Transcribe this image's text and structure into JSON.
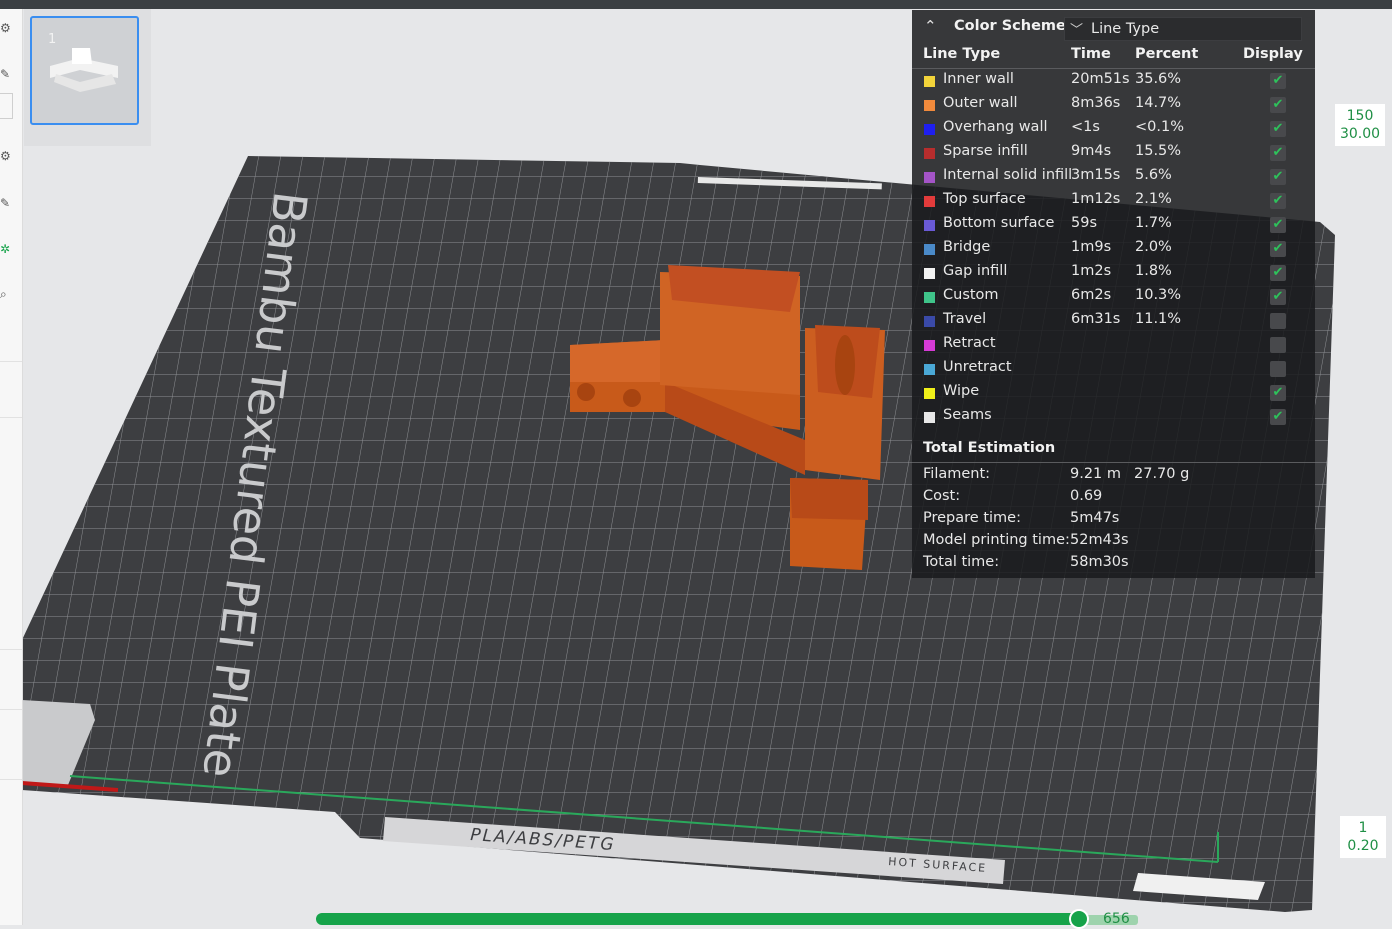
{
  "plate": {
    "name": "Bambu Textured PEI Plate",
    "filament_label": "PLA/ABS/PETG",
    "hot_surface_label": "HOT SURFACE",
    "thumbnail_number": "1"
  },
  "color_scheme": {
    "title": "Color Scheme",
    "selected": "Line Type",
    "columns": {
      "line_type": "Line Type",
      "time": "Time",
      "percent": "Percent",
      "display": "Display"
    },
    "rows": [
      {
        "name": "Inner wall",
        "time": "20m51s",
        "percent": "35.6%",
        "color": "#f3d43a",
        "display": true
      },
      {
        "name": "Outer wall",
        "time": "8m36s",
        "percent": "14.7%",
        "color": "#f18a3c",
        "display": true
      },
      {
        "name": "Overhang wall",
        "time": "<1s",
        "percent": "<0.1%",
        "color": "#1f1ff0",
        "display": true
      },
      {
        "name": "Sparse infill",
        "time": "9m4s",
        "percent": "15.5%",
        "color": "#b72d2d",
        "display": true
      },
      {
        "name": "Internal solid infill",
        "time": "3m15s",
        "percent": "5.6%",
        "color": "#a454c7",
        "display": true
      },
      {
        "name": "Top surface",
        "time": "1m12s",
        "percent": "2.1%",
        "color": "#e33b3b",
        "display": true
      },
      {
        "name": "Bottom surface",
        "time": "59s",
        "percent": "1.7%",
        "color": "#6a5ad6",
        "display": true
      },
      {
        "name": "Bridge",
        "time": "1m9s",
        "percent": "2.0%",
        "color": "#4a8ac9",
        "display": true
      },
      {
        "name": "Gap infill",
        "time": "1m2s",
        "percent": "1.8%",
        "color": "#f2f2f2",
        "display": true
      },
      {
        "name": "Custom",
        "time": "6m2s",
        "percent": "10.3%",
        "color": "#3fc48a",
        "display": true
      },
      {
        "name": "Travel",
        "time": "6m31s",
        "percent": "11.1%",
        "color": "#3a4aa8",
        "display": false
      },
      {
        "name": "Retract",
        "time": "",
        "percent": "",
        "color": "#d63bd6",
        "display": false
      },
      {
        "name": "Unretract",
        "time": "",
        "percent": "",
        "color": "#4aa8d6",
        "display": false
      },
      {
        "name": "Wipe",
        "time": "",
        "percent": "",
        "color": "#f0f01a",
        "display": true
      },
      {
        "name": "Seams",
        "time": "",
        "percent": "",
        "color": "#e8e8e8",
        "display": true
      }
    ]
  },
  "total_estimation": {
    "title": "Total Estimation",
    "filament_label": "Filament:",
    "filament_length": "9.21 m",
    "filament_weight": "27.70 g",
    "cost_label": "Cost:",
    "cost": "0.69",
    "prepare_label": "Prepare time:",
    "prepare": "5m47s",
    "model_label": "Model printing time:",
    "model": "52m43s",
    "total_label": "Total time:",
    "total": "58m30s"
  },
  "layer_slider": {
    "top_layer": "150",
    "top_height": "30.00",
    "bottom_layer": "1",
    "bottom_height": "0.20"
  },
  "move_slider": {
    "value": "656"
  },
  "icons": [
    "settings-icon",
    "edit-icon",
    "search-icon",
    "collapse-icon",
    "chevron-down-icon",
    "check-icon"
  ]
}
